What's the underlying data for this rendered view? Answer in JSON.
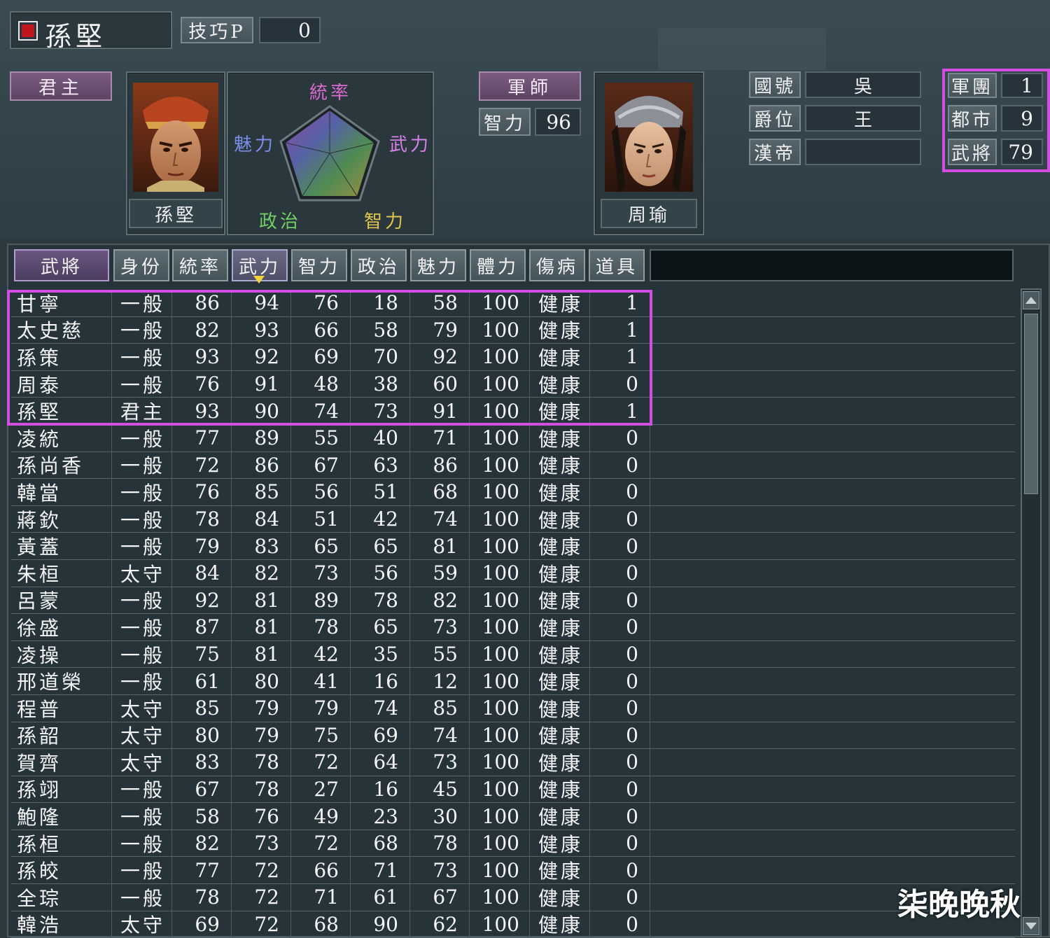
{
  "header": {
    "ruler_name": "孫堅",
    "skill_label": "技巧P",
    "skill_value": "0"
  },
  "ruler_panel": {
    "role_label": "君主",
    "portrait_name": "孫堅",
    "stats_chart_labels": {
      "top": "統率",
      "left": "魅力",
      "right": "武力",
      "bottom_left": "政治",
      "bottom_right": "智力"
    }
  },
  "advisor_panel": {
    "role_label": "軍師",
    "int_label": "智力",
    "int_value": "96",
    "portrait_name": "周瑜"
  },
  "nation_info": {
    "country_label": "國號",
    "country_value": "吳",
    "rank_label": "爵位",
    "rank_value": "王",
    "emperor_label": "漢帝",
    "emperor_value": ""
  },
  "force_info": {
    "corps_label": "軍團",
    "corps_value": "1",
    "city_label": "都市",
    "city_value": "9",
    "officer_label": "武將",
    "officer_value": "79"
  },
  "table": {
    "headers": [
      "武將",
      "身份",
      "統率",
      "武力",
      "智力",
      "政治",
      "魅力",
      "體力",
      "傷病",
      "道具"
    ],
    "rows": [
      [
        "甘寧",
        "一般",
        "86",
        "94",
        "76",
        "18",
        "58",
        "100",
        "健康",
        "1"
      ],
      [
        "太史慈",
        "一般",
        "82",
        "93",
        "66",
        "58",
        "79",
        "100",
        "健康",
        "1"
      ],
      [
        "孫策",
        "一般",
        "93",
        "92",
        "69",
        "70",
        "92",
        "100",
        "健康",
        "1"
      ],
      [
        "周泰",
        "一般",
        "76",
        "91",
        "48",
        "38",
        "60",
        "100",
        "健康",
        "0"
      ],
      [
        "孫堅",
        "君主",
        "93",
        "90",
        "74",
        "73",
        "91",
        "100",
        "健康",
        "1"
      ],
      [
        "凌統",
        "一般",
        "77",
        "89",
        "55",
        "40",
        "71",
        "100",
        "健康",
        "0"
      ],
      [
        "孫尚香",
        "一般",
        "72",
        "86",
        "67",
        "63",
        "86",
        "100",
        "健康",
        "0"
      ],
      [
        "韓當",
        "一般",
        "76",
        "85",
        "56",
        "51",
        "68",
        "100",
        "健康",
        "0"
      ],
      [
        "蔣欽",
        "一般",
        "78",
        "84",
        "51",
        "42",
        "74",
        "100",
        "健康",
        "0"
      ],
      [
        "黃蓋",
        "一般",
        "79",
        "83",
        "65",
        "65",
        "81",
        "100",
        "健康",
        "0"
      ],
      [
        "朱桓",
        "太守",
        "84",
        "82",
        "73",
        "56",
        "59",
        "100",
        "健康",
        "0"
      ],
      [
        "呂蒙",
        "一般",
        "92",
        "81",
        "89",
        "78",
        "82",
        "100",
        "健康",
        "0"
      ],
      [
        "徐盛",
        "一般",
        "87",
        "81",
        "78",
        "65",
        "73",
        "100",
        "健康",
        "0"
      ],
      [
        "凌操",
        "一般",
        "75",
        "81",
        "42",
        "35",
        "55",
        "100",
        "健康",
        "0"
      ],
      [
        "邢道榮",
        "一般",
        "61",
        "80",
        "41",
        "16",
        "12",
        "100",
        "健康",
        "0"
      ],
      [
        "程普",
        "太守",
        "85",
        "79",
        "79",
        "74",
        "85",
        "100",
        "健康",
        "0"
      ],
      [
        "孫韶",
        "太守",
        "80",
        "79",
        "75",
        "69",
        "74",
        "100",
        "健康",
        "0"
      ],
      [
        "賀齊",
        "太守",
        "83",
        "78",
        "72",
        "64",
        "73",
        "100",
        "健康",
        "0"
      ],
      [
        "孫翊",
        "一般",
        "67",
        "78",
        "27",
        "16",
        "45",
        "100",
        "健康",
        "0"
      ],
      [
        "鮑隆",
        "一般",
        "58",
        "76",
        "49",
        "23",
        "30",
        "100",
        "健康",
        "0"
      ],
      [
        "孫桓",
        "一般",
        "82",
        "73",
        "72",
        "68",
        "78",
        "100",
        "健康",
        "0"
      ],
      [
        "孫皎",
        "一般",
        "77",
        "72",
        "66",
        "71",
        "73",
        "100",
        "健康",
        "0"
      ],
      [
        "全琮",
        "一般",
        "78",
        "72",
        "71",
        "61",
        "67",
        "100",
        "健康",
        "0"
      ],
      [
        "韓浩",
        "太守",
        "69",
        "72",
        "68",
        "90",
        "62",
        "100",
        "健康",
        "0"
      ]
    ]
  },
  "watermark": "柒晚晚秋"
}
